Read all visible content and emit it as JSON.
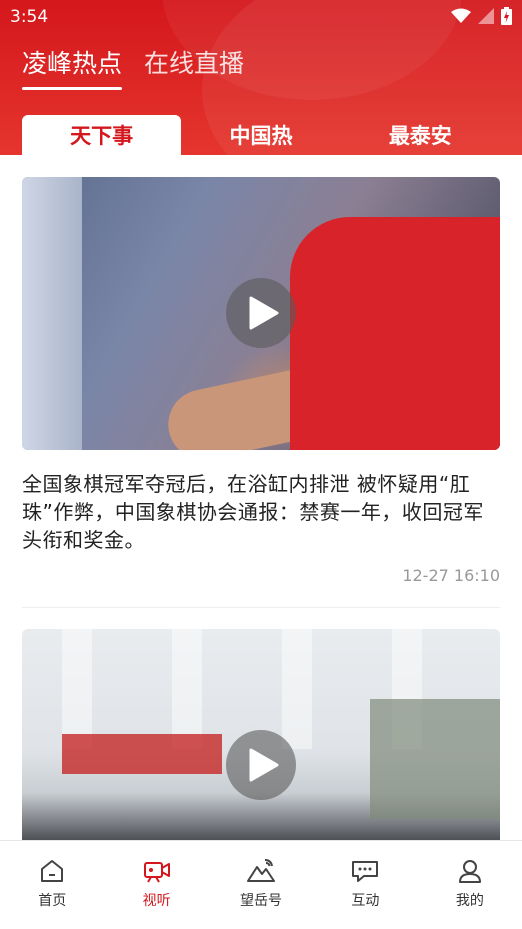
{
  "status_bar": {
    "time": "3:54"
  },
  "top_tabs": [
    {
      "label": "凌峰热点",
      "active": true
    },
    {
      "label": "在线直播",
      "active": false
    }
  ],
  "sub_tabs": [
    {
      "label": "天下事",
      "active": true
    },
    {
      "label": "中国热",
      "active": false
    },
    {
      "label": "最泰安",
      "active": false
    }
  ],
  "articles": [
    {
      "title": "全国象棋冠军夺冠后，在浴缸内排泄 被怀疑用“肛珠”作弊，中国象棋协会通报：禁赛一年，收回冠军头衔和奖金。",
      "time": "12-27 16:10"
    },
    {
      "title": "",
      "time": ""
    }
  ],
  "bottom_nav": [
    {
      "label": "首页",
      "icon": "home-icon",
      "active": false
    },
    {
      "label": "视听",
      "icon": "video-icon",
      "active": true
    },
    {
      "label": "望岳号",
      "icon": "mountain-icon",
      "active": false
    },
    {
      "label": "互动",
      "icon": "chat-icon",
      "active": false
    },
    {
      "label": "我的",
      "icon": "user-icon",
      "active": false
    }
  ],
  "colors": {
    "brand_red": "#d4171c",
    "active_nav": "#d4171c"
  }
}
